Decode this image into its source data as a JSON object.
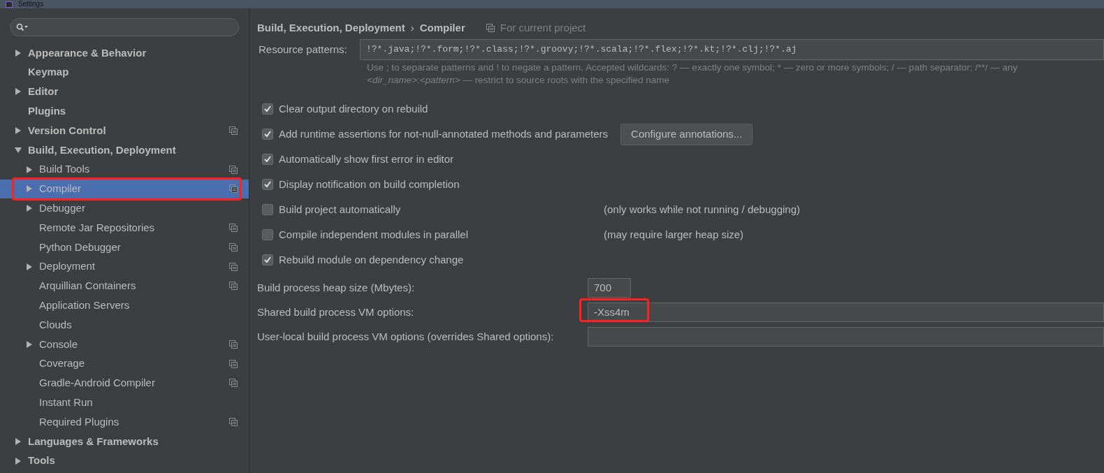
{
  "window": {
    "title": "Settings"
  },
  "tree": [
    {
      "label": "Appearance & Behavior",
      "expandable": true,
      "expanded": false,
      "selected": false,
      "project_level": false
    },
    {
      "label": "Keymap",
      "expandable": false,
      "selected": false,
      "project_level": false
    },
    {
      "label": "Editor",
      "expandable": true,
      "expanded": false,
      "selected": false,
      "project_level": false
    },
    {
      "label": "Plugins",
      "expandable": false,
      "selected": false,
      "project_level": false
    },
    {
      "label": "Version Control",
      "expandable": true,
      "expanded": false,
      "selected": false,
      "project_level": true
    },
    {
      "label": "Build, Execution, Deployment",
      "expandable": true,
      "expanded": true,
      "selected": false,
      "project_level": false,
      "children": [
        {
          "label": "Build Tools",
          "expandable": true,
          "expanded": false,
          "selected": false,
          "project_level": true
        },
        {
          "label": "Compiler",
          "expandable": true,
          "expanded": false,
          "selected": true,
          "project_level": true,
          "annotated": true
        },
        {
          "label": "Debugger",
          "expandable": true,
          "expanded": false,
          "selected": false,
          "project_level": false
        },
        {
          "label": "Remote Jar Repositories",
          "expandable": false,
          "selected": false,
          "project_level": true
        },
        {
          "label": "Python Debugger",
          "expandable": false,
          "selected": false,
          "project_level": true
        },
        {
          "label": "Deployment",
          "expandable": true,
          "expanded": false,
          "selected": false,
          "project_level": true
        },
        {
          "label": "Arquillian Containers",
          "expandable": false,
          "selected": false,
          "project_level": true
        },
        {
          "label": "Application Servers",
          "expandable": false,
          "selected": false,
          "project_level": false
        },
        {
          "label": "Clouds",
          "expandable": false,
          "selected": false,
          "project_level": false
        },
        {
          "label": "Console",
          "expandable": true,
          "expanded": false,
          "selected": false,
          "project_level": true
        },
        {
          "label": "Coverage",
          "expandable": false,
          "selected": false,
          "project_level": true
        },
        {
          "label": "Gradle-Android Compiler",
          "expandable": false,
          "selected": false,
          "project_level": true
        },
        {
          "label": "Instant Run",
          "expandable": false,
          "selected": false,
          "project_level": false
        },
        {
          "label": "Required Plugins",
          "expandable": false,
          "selected": false,
          "project_level": true
        }
      ]
    },
    {
      "label": "Languages & Frameworks",
      "expandable": true,
      "expanded": false,
      "selected": false,
      "project_level": false
    },
    {
      "label": "Tools",
      "expandable": true,
      "expanded": false,
      "selected": false,
      "project_level": false
    }
  ],
  "breadcrumb": {
    "parent": "Build, Execution, Deployment",
    "separator": "›",
    "current": "Compiler",
    "scope": "For current project"
  },
  "resource_patterns": {
    "label": "Resource patterns:",
    "value": "!?*.java;!?*.form;!?*.class;!?*.groovy;!?*.scala;!?*.flex;!?*.kt;!?*.clj;!?*.aj",
    "hint": "Use ; to separate patterns and ! to negate a pattern. Accepted wildcards: ? — exactly one symbol; * — zero or more symbols; / — path separator; /**/ — any",
    "hint_2": "*<dir_name>*:*<pattern>* — restrict to source roots with the specified name"
  },
  "options": [
    {
      "label": "Clear output directory on rebuild",
      "checked": true
    },
    {
      "label": "Add runtime assertions for not-null-annotated methods and parameters",
      "checked": true,
      "button": "Configure annotations..."
    },
    {
      "label": "Automatically show first error in editor",
      "checked": true
    },
    {
      "label": "Display notification on build completion",
      "checked": true
    },
    {
      "label": "Build project automatically",
      "checked": false,
      "note": "(only works while not running / debugging)"
    },
    {
      "label": "Compile independent modules in parallel",
      "checked": false,
      "note": "(may require larger heap size)"
    },
    {
      "label": "Rebuild module on dependency change",
      "checked": true
    }
  ],
  "fields": [
    {
      "kind": "short",
      "label": "Build process heap size (Mbytes):",
      "value": "700",
      "annotated": false
    },
    {
      "kind": "wide",
      "label": "Shared build process VM options:",
      "value": "-Xss4m",
      "annotated": true
    },
    {
      "kind": "wide",
      "label": "User-local build process VM options (overrides Shared options):",
      "annotated": false
    }
  ]
}
